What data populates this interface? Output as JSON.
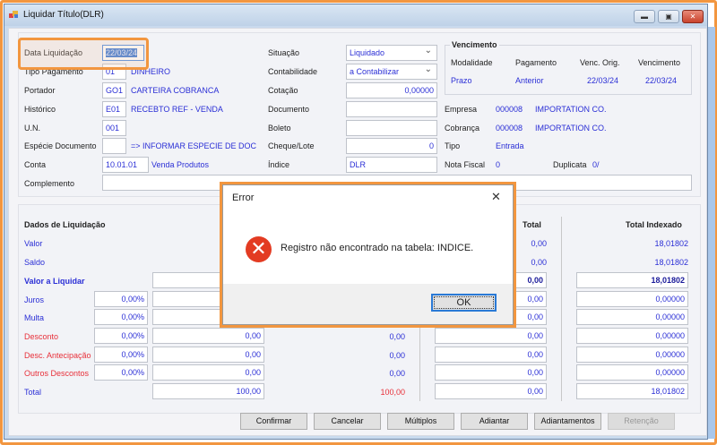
{
  "window": {
    "title": "Liquidar Título(DLR)",
    "minimize": "▬",
    "maximize": "▣",
    "close": "✕"
  },
  "form": {
    "data_liquidacao": {
      "label": "Data Liquidação",
      "value": "22/03/24"
    },
    "tipo_pagamento": {
      "label": "Tipo Pagamento",
      "code": "01",
      "desc": "DINHEIRO"
    },
    "portador": {
      "label": "Portador",
      "code": "GO1",
      "desc": "CARTEIRA COBRANCA"
    },
    "historico": {
      "label": "Histórico",
      "code": "E01",
      "desc": "RECEBTO REF - VENDA"
    },
    "un": {
      "label": "U.N.",
      "code": "001"
    },
    "especie": {
      "label": "Espécie Documento",
      "code": "",
      "desc": "=> INFORMAR ESPECIE DE DOCUME"
    },
    "conta": {
      "label": "Conta",
      "code": "10.01.01",
      "desc": "Venda Produtos"
    },
    "complemento": {
      "label": "Complemento",
      "value": ""
    },
    "situacao": {
      "label": "Situação",
      "value": "Liquidado"
    },
    "contabilidade": {
      "label": "Contabilidade",
      "value": "a Contabilizar"
    },
    "cotacao": {
      "label": "Cotação",
      "value": "0,00000"
    },
    "documento": {
      "label": "Documento",
      "value": ""
    },
    "boleto": {
      "label": "Boleto",
      "value": ""
    },
    "cheque": {
      "label": "Cheque/Lote",
      "value": "0"
    },
    "indice": {
      "label": "Índice",
      "value": "DLR"
    }
  },
  "vencimento": {
    "title": "Vencimento",
    "headers": [
      "Modalidade",
      "Pagamento",
      "Venc. Orig.",
      "Vencimento"
    ],
    "values": [
      "Prazo",
      "Anterior",
      "22/03/24",
      "22/03/24"
    ]
  },
  "info": {
    "empresa": {
      "label": "Empresa",
      "code": "000008",
      "name": "IMPORTATION CO."
    },
    "cobranca": {
      "label": "Cobrança",
      "code": "000008",
      "name": "IMPORTATION CO."
    },
    "tipo": {
      "label": "Tipo",
      "value": "Entrada"
    },
    "nota_fiscal": {
      "label": "Nota Fiscal",
      "value": "0"
    },
    "duplicata": {
      "label": "Duplicata",
      "value": "0/"
    }
  },
  "liquidacao": {
    "title": "Dados de Liquidação",
    "total_header": "Total",
    "indexado_header": "Total Indexado",
    "rows": [
      {
        "label": "Valor",
        "pct": null,
        "val": null,
        "mid": null,
        "total": "0,00",
        "indexado": "18,01802",
        "style": "blue",
        "kind": "text"
      },
      {
        "label": "Saldo",
        "pct": null,
        "val": null,
        "mid": null,
        "total": "0,00",
        "indexado": "18,01802",
        "style": "blue",
        "kind": "text"
      },
      {
        "label": "Valor a Liquidar",
        "pct": null,
        "val": "",
        "mid": null,
        "total": "0,00",
        "indexado": "18,01802",
        "style": "bold",
        "kind": "input"
      },
      {
        "label": "Juros",
        "pct": "0,00%",
        "val": "",
        "mid": null,
        "total": "0,00",
        "indexado": "0,00000",
        "style": "blue",
        "kind": "input"
      },
      {
        "label": "Multa",
        "pct": "0,00%",
        "val": "",
        "mid": null,
        "total": "0,00",
        "indexado": "0,00000",
        "style": "blue",
        "kind": "input"
      },
      {
        "label": "Desconto",
        "pct": "0,00%",
        "val": "0,00",
        "mid": "0,00",
        "total": "0,00",
        "indexado": "0,00000",
        "style": "red",
        "kind": "input"
      },
      {
        "label": "Desc. Antecipação",
        "pct": "0,00%",
        "val": "0,00",
        "mid": "0,00",
        "total": "0,00",
        "indexado": "0,00000",
        "style": "red",
        "kind": "input"
      },
      {
        "label": "Outros Descontos",
        "pct": "0,00%",
        "val": "0,00",
        "mid": "0,00",
        "total": "0,00",
        "indexado": "0,00000",
        "style": "red",
        "kind": "input"
      },
      {
        "label": "Total",
        "pct": null,
        "val": "100,00",
        "mid": "100,00",
        "total": "0,00",
        "indexado": "18,01802",
        "style": "blue",
        "kind": "input"
      }
    ]
  },
  "buttons": [
    "Confirmar",
    "Cancelar",
    "Múltiplos",
    "Adiantar",
    "Adiantamentos",
    "Retenção"
  ],
  "dialog": {
    "title": "Error",
    "message": "Registro não encontrado na tabela: INDICE.",
    "ok": "OK",
    "close": "✕",
    "icon": "✕"
  }
}
